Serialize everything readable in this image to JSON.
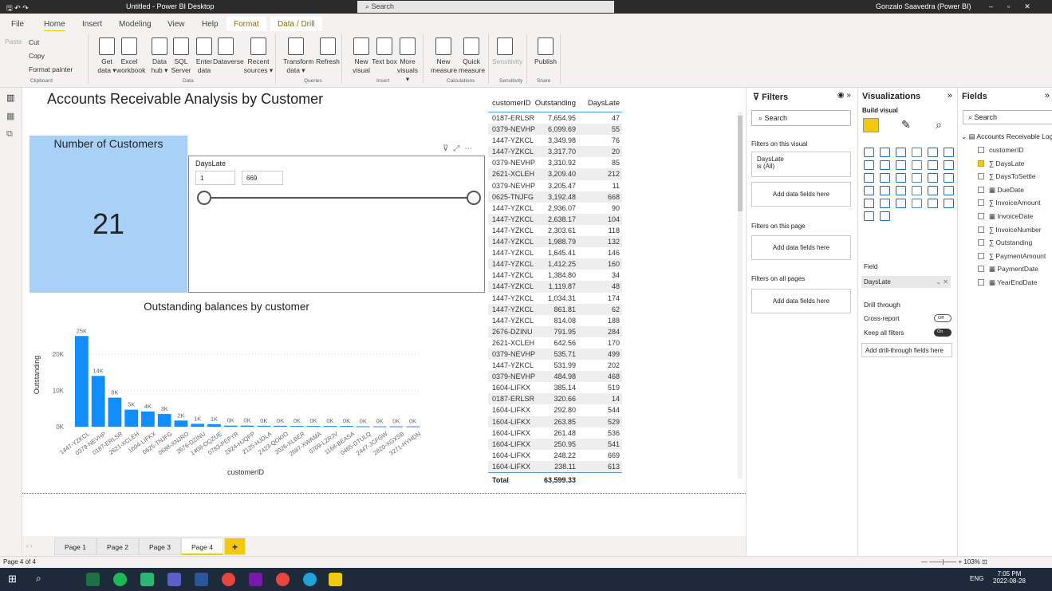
{
  "titlebar": {
    "title": "Untitled - Power BI Desktop",
    "search": "Search",
    "user": "Gonzalo Saavedra (Power BI)"
  },
  "tabs": [
    "File",
    "Home",
    "Insert",
    "Modeling",
    "View",
    "Help",
    "Format",
    "Data / Drill"
  ],
  "ribbon": {
    "clipboard": {
      "paste": "Paste",
      "cut": "Cut",
      "copy": "Copy",
      "format_painter": "Format painter",
      "group": "Clipboard"
    },
    "data": {
      "buttons": [
        "Get data ▾",
        "Excel workbook",
        "Data hub ▾",
        "SQL Server",
        "Enter data",
        "Dataverse",
        "Recent sources ▾"
      ],
      "group": "Data"
    },
    "queries": {
      "buttons": [
        "Transform data ▾",
        "Refresh"
      ],
      "group": "Queries"
    },
    "insert": {
      "buttons": [
        "New visual",
        "Text box",
        "More visuals ▾"
      ],
      "group": "Insert"
    },
    "calculations": {
      "buttons": [
        "New measure",
        "Quick measure"
      ],
      "group": "Calculations"
    },
    "sensitivity": {
      "buttons": [
        "Sensitivity"
      ],
      "group": "Sensitivity"
    },
    "share": {
      "buttons": [
        "Publish"
      ],
      "group": "Share"
    }
  },
  "report": {
    "title": "Accounts Receivable Analysis by Customer"
  },
  "card": {
    "label": "Number of Customers",
    "value": "21"
  },
  "slicer": {
    "label": "DaysLate",
    "min": "1",
    "max": "669"
  },
  "chart_data": {
    "type": "bar",
    "title": "Outstanding balances by customer",
    "xlabel": "customerID",
    "ylabel": "Outstanding",
    "categories": [
      "1447-YZKCL",
      "0379-NEVHP",
      "0187-ERLSR",
      "2621-XCLEH",
      "1604-LIFKX",
      "0625-TNJFG",
      "0688-XNJRO",
      "2676-DZINU",
      "1408-OQZUE",
      "0783-PEPYR",
      "2824-HJQPP",
      "2125-HJDLA",
      "2423-QOKIO",
      "2026-XLBER",
      "2687-XWAMA",
      "0709-LZRJV",
      "1168-BEASA",
      "0465-DTULQ",
      "2447-JCFGW",
      "2820-XGXSB",
      "3271-HYHDN"
    ],
    "values": [
      25000,
      14000,
      8000,
      4700,
      4200,
      3500,
      1700,
      800,
      700,
      300,
      300,
      250,
      250,
      200,
      200,
      200,
      200,
      100,
      100,
      100,
      100
    ],
    "labels": [
      "25K",
      "14K",
      "8K",
      "5K",
      "4K",
      "3K",
      "2K",
      "1K",
      "1K",
      "0K",
      "0K",
      "0K",
      "0K",
      "0K",
      "0K",
      "0K",
      "0K",
      "0K",
      "0K",
      "0K",
      "0K"
    ],
    "yticks": [
      "0K",
      "10K",
      "20K"
    ],
    "ylim": [
      0,
      27000
    ],
    "grid": true,
    "color": "#118dff"
  },
  "table": {
    "headers": [
      "customerID",
      "Outstanding",
      "DaysLate"
    ],
    "rows": [
      [
        "0187-ERLSR",
        "7,654.95",
        "47"
      ],
      [
        "0379-NEVHP",
        "6,099.69",
        "55"
      ],
      [
        "1447-YZKCL",
        "3,349.98",
        "76"
      ],
      [
        "1447-YZKCL",
        "3,317.70",
        "20"
      ],
      [
        "0379-NEVHP",
        "3,310.92",
        "85"
      ],
      [
        "2621-XCLEH",
        "3,209.40",
        "212"
      ],
      [
        "0379-NEVHP",
        "3,205.47",
        "11"
      ],
      [
        "0625-TNJFG",
        "3,192.48",
        "668"
      ],
      [
        "1447-YZKCL",
        "2,936.07",
        "90"
      ],
      [
        "1447-YZKCL",
        "2,638.17",
        "104"
      ],
      [
        "1447-YZKCL",
        "2,303.61",
        "118"
      ],
      [
        "1447-YZKCL",
        "1,988.79",
        "132"
      ],
      [
        "1447-YZKCL",
        "1,645.41",
        "146"
      ],
      [
        "1447-YZKCL",
        "1,412.25",
        "160"
      ],
      [
        "1447-YZKCL",
        "1,384.80",
        "34"
      ],
      [
        "1447-YZKCL",
        "1,119.87",
        "48"
      ],
      [
        "1447-YZKCL",
        "1,034.31",
        "174"
      ],
      [
        "1447-YZKCL",
        "861.81",
        "62"
      ],
      [
        "1447-YZKCL",
        "814.08",
        "188"
      ],
      [
        "2676-DZINU",
        "791.95",
        "284"
      ],
      [
        "2621-XCLEH",
        "642.56",
        "170"
      ],
      [
        "0379-NEVHP",
        "535.71",
        "499"
      ],
      [
        "1447-YZKCL",
        "531.99",
        "202"
      ],
      [
        "0379-NEVHP",
        "484.98",
        "468"
      ],
      [
        "1604-LIFKX",
        "385.14",
        "519"
      ],
      [
        "0187-ERLSR",
        "320.66",
        "14"
      ],
      [
        "1604-LIFKX",
        "292.80",
        "544"
      ],
      [
        "1604-LIFKX",
        "263.85",
        "529"
      ],
      [
        "1604-LIFKX",
        "261.48",
        "536"
      ],
      [
        "1604-LIFKX",
        "250.95",
        "541"
      ],
      [
        "1604-LIFKX",
        "248.22",
        "669"
      ],
      [
        "1604-LIFKX",
        "238.11",
        "613"
      ]
    ],
    "total_label": "Total",
    "total": "63,599.33"
  },
  "filters": {
    "title": "Filters",
    "search": "Search",
    "on_visual": "Filters on this visual",
    "card_field": "DaysLate",
    "card_value": "is (All)",
    "add": "Add data fields here",
    "on_page": "Filters on this page",
    "on_all": "Filters on all pages"
  },
  "viz": {
    "title": "Visualizations",
    "build": "Build visual",
    "field_label": "Field",
    "field_value": "DaysLate",
    "drill": "Drill through",
    "cross": "Cross-report",
    "cross_state": "Off",
    "keep": "Keep all filters",
    "keep_state": "On",
    "add_drill": "Add drill-through fields here"
  },
  "fields": {
    "title": "Fields",
    "search": "Search",
    "table": "Accounts Receivable Log",
    "items": [
      {
        "name": "customerID",
        "checked": false
      },
      {
        "name": "∑ DaysLate",
        "checked": true
      },
      {
        "name": "∑ DaysToSettle",
        "checked": false
      },
      {
        "name": "▦ DueDate",
        "checked": false
      },
      {
        "name": "∑ InvoiceAmount",
        "checked": false
      },
      {
        "name": "▦ InvoiceDate",
        "checked": false
      },
      {
        "name": "∑ InvoiceNumber",
        "checked": false
      },
      {
        "name": "∑ Outstanding",
        "checked": false
      },
      {
        "name": "∑ PaymentAmount",
        "checked": false
      },
      {
        "name": "▦ PaymentDate",
        "checked": false
      },
      {
        "name": "▦ YearEndDate",
        "checked": false
      }
    ]
  },
  "pages": [
    "Page 1",
    "Page 2",
    "Page 3",
    "Page 4"
  ],
  "active_page": "Page 4",
  "add_page": "+",
  "status": {
    "page": "Page 4 of 4",
    "zoom": "103%"
  },
  "taskbar": {
    "time": "7:05 PM",
    "date": "2022-08-28",
    "lang": "ENG"
  }
}
